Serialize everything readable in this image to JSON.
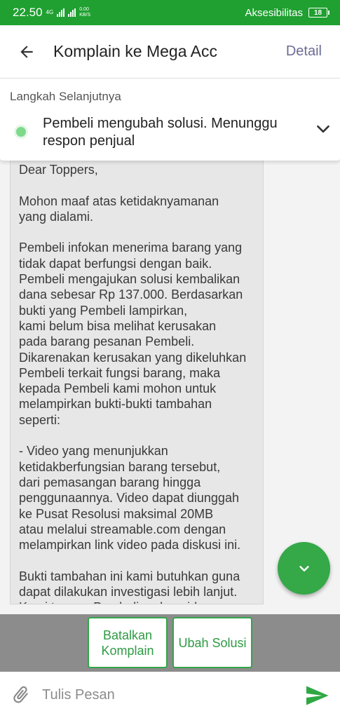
{
  "status_bar": {
    "time": "22.50",
    "network": "4G",
    "net_speed_value": "0.00",
    "net_speed_unit": "KB/S",
    "accessibility_label": "Aksesibilitas",
    "battery": "18"
  },
  "header": {
    "title": "Komplain ke Mega Acc",
    "detail_label": "Detail",
    "back_icon": "arrow-left-icon"
  },
  "next_step": {
    "title": "Langkah Selanjutnya",
    "status_text": "Pembeli mengubah solusi. Menunggu respon penjual",
    "status_color": "#7fd98a",
    "expand_icon": "chevron-down-icon"
  },
  "message": {
    "body": "Dear Toppers,\n\nMohon maaf atas ketidaknyamanan\nyang dialami.\n\nPembeli infokan menerima barang yang\ntidak dapat berfungsi dengan baik.\nPembeli mengajukan solusi kembalikan\ndana sebesar Rp 137.000. Berdasarkan\nbukti yang Pembeli lampirkan,\nkami belum bisa melihat kerusakan\npada barang pesanan Pembeli.\nDikarenakan kerusakan yang dikeluhkan\nPembeli terkait fungsi barang, maka\nkepada Pembeli kami mohon untuk\nmelampirkan bukti-bukti tambahan\nseperti:\n\n- Video yang menunjukkan\nketidakberfungsian barang tersebut,\ndari pemasangan barang hingga\npenggunaannya. Video dapat diunggah\nke Pusat Resolusi maksimal 20MB\natau melalui streamable.com dengan\nmelampirkan link video pada diskusi ini.\n\nBukti tambahan ini kami butuhkan guna\ndapat dilakukan investigasi lebih lanjut.\nKami tunggu Pembeli melampirkan"
  },
  "actions": {
    "cancel_label": "Batalkan\nKomplain",
    "change_label": "Ubah Solusi"
  },
  "composer": {
    "placeholder": "Tulis Pesan",
    "value": "",
    "attach_icon": "paperclip-icon",
    "send_icon": "send-icon"
  },
  "colors": {
    "primary_green": "#1fa030",
    "button_green": "#2e9b44",
    "fab_green": "#35a848"
  }
}
